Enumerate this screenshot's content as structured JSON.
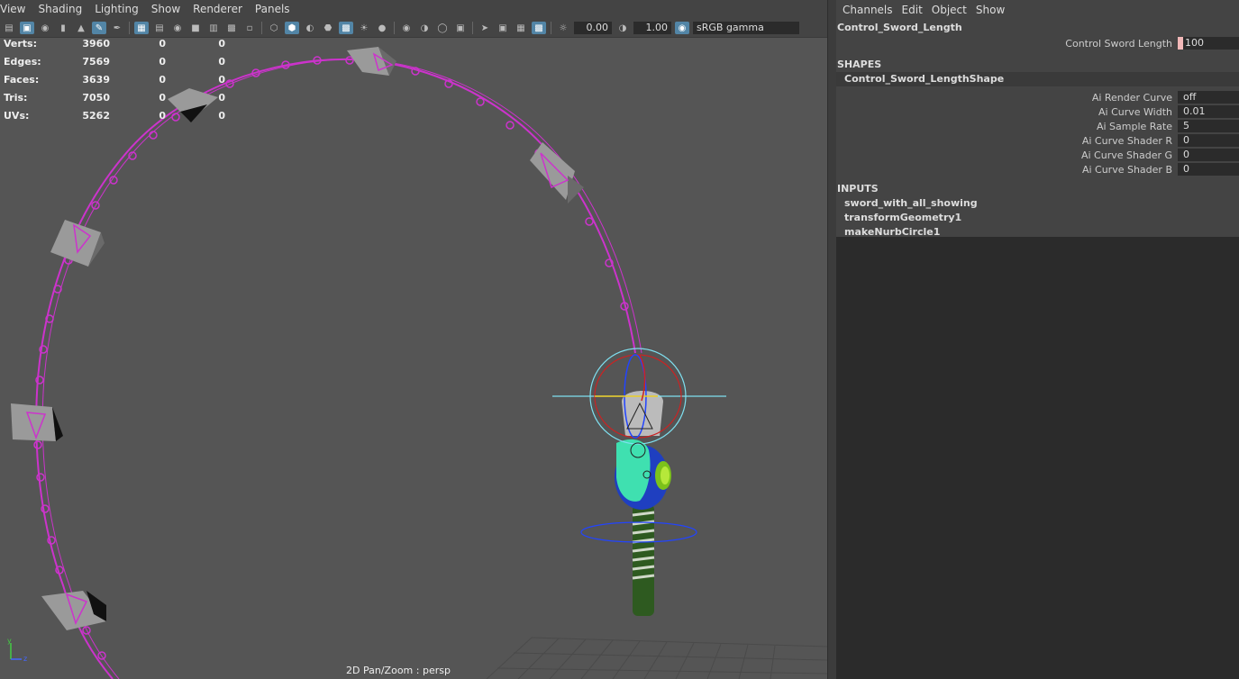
{
  "viewport": {
    "menu": [
      "View",
      "Shading",
      "Lighting",
      "Show",
      "Renderer",
      "Panels"
    ],
    "toolbar": {
      "exposure": "0.00",
      "gamma": "1.00",
      "color_space": "sRGB gamma"
    },
    "hud": [
      {
        "label": "Verts:",
        "v1": "3960",
        "v2": "0",
        "v3": "0"
      },
      {
        "label": "Edges:",
        "v1": "7569",
        "v2": "0",
        "v3": "0"
      },
      {
        "label": "Faces:",
        "v1": "3639",
        "v2": "0",
        "v3": "0"
      },
      {
        "label": "Tris:",
        "v1": "7050",
        "v2": "0",
        "v3": "0"
      },
      {
        "label": "UVs:",
        "v1": "5262",
        "v2": "0",
        "v3": "0"
      }
    ],
    "camera_label": "2D Pan/Zoom : persp",
    "axis": {
      "y": "y",
      "z": "z"
    }
  },
  "channel_box": {
    "menu": [
      "Channels",
      "Edit",
      "Object",
      "Show"
    ],
    "node_name": "Control_Sword_Length",
    "main_attr": {
      "label": "Control Sword Length",
      "value": "100"
    },
    "shapes_header": "SHAPES",
    "shape_name": "Control_Sword_LengthShape",
    "shape_attrs": [
      {
        "label": "Ai Render Curve",
        "value": "off"
      },
      {
        "label": "Ai Curve Width",
        "value": "0.01"
      },
      {
        "label": "Ai Sample Rate",
        "value": "5"
      },
      {
        "label": "Ai Curve Shader R",
        "value": "0"
      },
      {
        "label": "Ai Curve Shader G",
        "value": "0"
      },
      {
        "label": "Ai Curve Shader B",
        "value": "0"
      }
    ],
    "inputs_header": "INPUTS",
    "inputs": [
      "sword_with_all_showing",
      "transformGeometry1",
      "makeNurbCircle1"
    ]
  },
  "colors": {
    "curve": "#cc33cc",
    "accent": "#5285a6",
    "manipulator_cyan": "#7fe0f0",
    "handle_green": "#2a5a22",
    "hilt_blue": "#1f3fc0",
    "hilt_teal": "#3fe0b0"
  }
}
